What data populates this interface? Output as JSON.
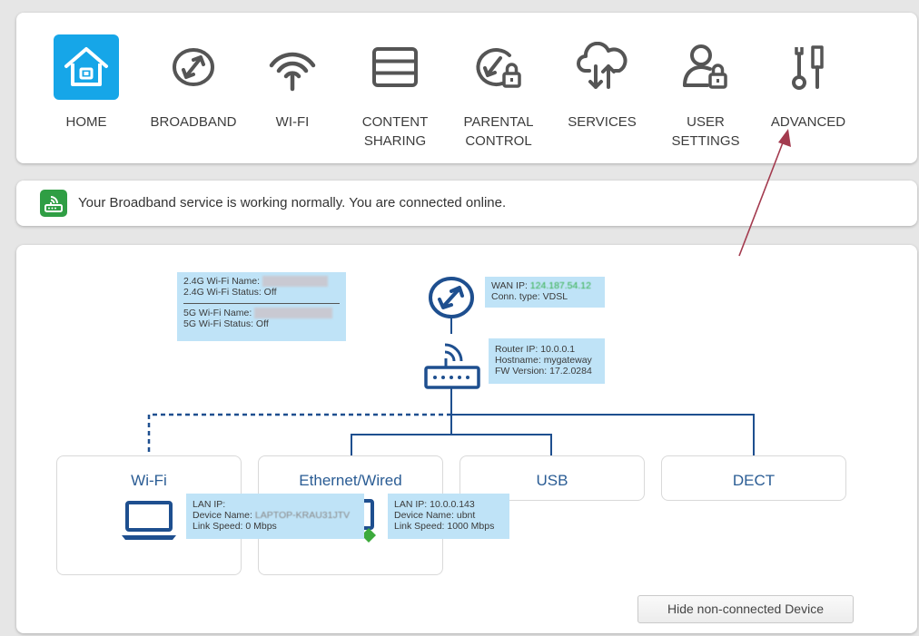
{
  "nav": {
    "items": [
      {
        "label": "HOME",
        "icon": "home-icon",
        "active": true
      },
      {
        "label": "BROADBAND",
        "icon": "broadband-globe-icon"
      },
      {
        "label": "WI-FI",
        "icon": "wifi-icon"
      },
      {
        "label": "CONTENT\nSHARING",
        "icon": "content-sharing-icon"
      },
      {
        "label": "PARENTAL\nCONTROL",
        "icon": "parental-control-icon"
      },
      {
        "label": "SERVICES",
        "icon": "cloud-services-icon"
      },
      {
        "label": "USER\nSETTINGS",
        "icon": "user-settings-icon"
      },
      {
        "label": "ADVANCED",
        "icon": "advanced-tools-icon"
      }
    ]
  },
  "status": {
    "message": "Your Broadband service is working normally. You are connected online.",
    "icon": "router-status-icon",
    "color": "#2f9e44"
  },
  "network_map": {
    "wifi_info": {
      "name_24_label": "2.4G Wi-Fi Name:",
      "status_24": "2.4G Wi-Fi Status: Off",
      "name_5_label": "5G Wi-Fi Name:",
      "status_5": "5G Wi-Fi Status: Off"
    },
    "wan_info": {
      "ip_label": "WAN IP:",
      "ip_value": "124.187.54.12",
      "conn_type": "Conn. type: VDSL"
    },
    "router_info": {
      "ip": "Router IP: 10.0.0.1",
      "hostname": "Hostname: mygateway",
      "fw": "FW Version: 17.2.0284"
    },
    "groups": {
      "wifi": "Wi-Fi",
      "ethernet": "Ethernet/Wired",
      "usb": "USB",
      "dect": "DECT"
    },
    "wifi_device": {
      "lan_ip": "LAN IP:",
      "device_name_label": "Device Name:",
      "device_name_value": "LAPTOP-KRAU31JTV",
      "link_speed": "Link Speed: 0 Mbps"
    },
    "eth_device": {
      "lan_ip": "LAN IP: 10.0.0.143",
      "device_name": "Device Name: ubnt",
      "link_speed": "Link Speed: 1000 Mbps"
    },
    "hide_button": "Hide non-connected Device"
  },
  "colors": {
    "accent": "#16a6e8",
    "map_blue": "#1e4f8f",
    "tooltip_bg": "#bfe3f7",
    "status_green": "#2f9e44",
    "annotation_arrow": "#a33a4e"
  }
}
